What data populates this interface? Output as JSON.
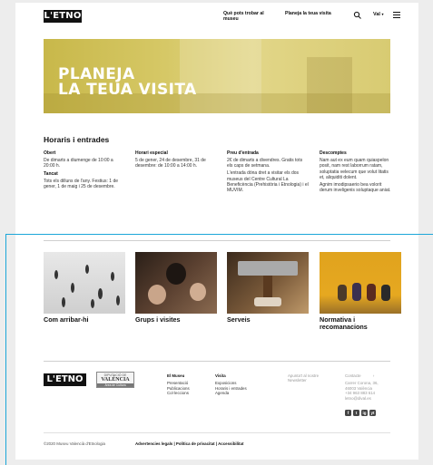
{
  "header": {
    "logo": "L'ETNO",
    "nav": [
      "Què pots trobar al museu",
      "Planeja la teua visita"
    ],
    "search_icon": "search-icon",
    "language": "Val",
    "menu_icon": "hamburger-icon"
  },
  "hero": {
    "line1": "PLANEJA",
    "line2": "LA TEUA VISITA"
  },
  "schedule": {
    "title": "Horaris i entrades",
    "columns": [
      {
        "blocks": [
          {
            "heading": "Obert",
            "text": "De dimarts a diumenge de 10:00 a 20:00 h."
          },
          {
            "heading": "Tancat",
            "text": "Tots els dilluns de l'any. Festius: 1 de gener, 1 de maig i 25 de desembre."
          }
        ]
      },
      {
        "blocks": [
          {
            "heading": "Horari especial",
            "text": "5 de gener, 24 de desembre, 31 de desembre: de 10:00 a 14:00 h."
          }
        ]
      },
      {
        "blocks": [
          {
            "heading": "Preu d'entrada",
            "text": "2€ de dimarts a divendres. Gratis tots els caps de setmana."
          },
          {
            "heading": "",
            "text": "L'entrada dóna dret a visitar els dos museus del Centre Cultural La Beneficència (Prehistòria i Etnologia) i el MUVIM."
          }
        ]
      },
      {
        "blocks": [
          {
            "heading": "Descomptes",
            "text": "Nam aut ex eum quam quiaspelon posit, nam rest laborrum ratam, soluptatia velecum que volut litatis et, aliquiditi dolent."
          },
          {
            "heading": "",
            "text": "Agnim imodipsaerio bea volorit derum inveligenis soluptaque aniat."
          }
        ]
      }
    ]
  },
  "cards": [
    {
      "label": "Com arribar-hi"
    },
    {
      "label": "Grups i visites"
    },
    {
      "label": "Serveis"
    },
    {
      "label": "Normativa i recomanacions"
    }
  ],
  "footer": {
    "logo": "L'ETNO",
    "partner_logo": {
      "top": "DIPUTACIÓ DE",
      "main": "VALÈNCIA",
      "strip": "Àrea de Cultura"
    },
    "museum": {
      "heading": "El Museu",
      "links": [
        "Presentació",
        "Publicacions",
        "Col·leccions"
      ]
    },
    "visit": {
      "heading": "Visita",
      "links": [
        "Exposicions",
        "Horaris i entrades",
        "Agenda"
      ]
    },
    "newsletter": {
      "heading": "Apunta't al nostre Newsletter"
    },
    "contact": {
      "heading": "Contacte",
      "arrow": "›",
      "lines": [
        "Carrer Corona, 36,",
        "46003 València",
        "+34 963 883 614",
        "letno@dival.es"
      ]
    },
    "social": [
      "f",
      "t",
      "ig",
      "yt"
    ],
    "copyright": "©2020 Museu Valencià d'Etnologia",
    "legal": "Advertencies legals | Política de privacitat | Accessibilitat"
  },
  "colors": {
    "accent_overlay": "#1ba6d9",
    "hero": "#d6c866"
  }
}
